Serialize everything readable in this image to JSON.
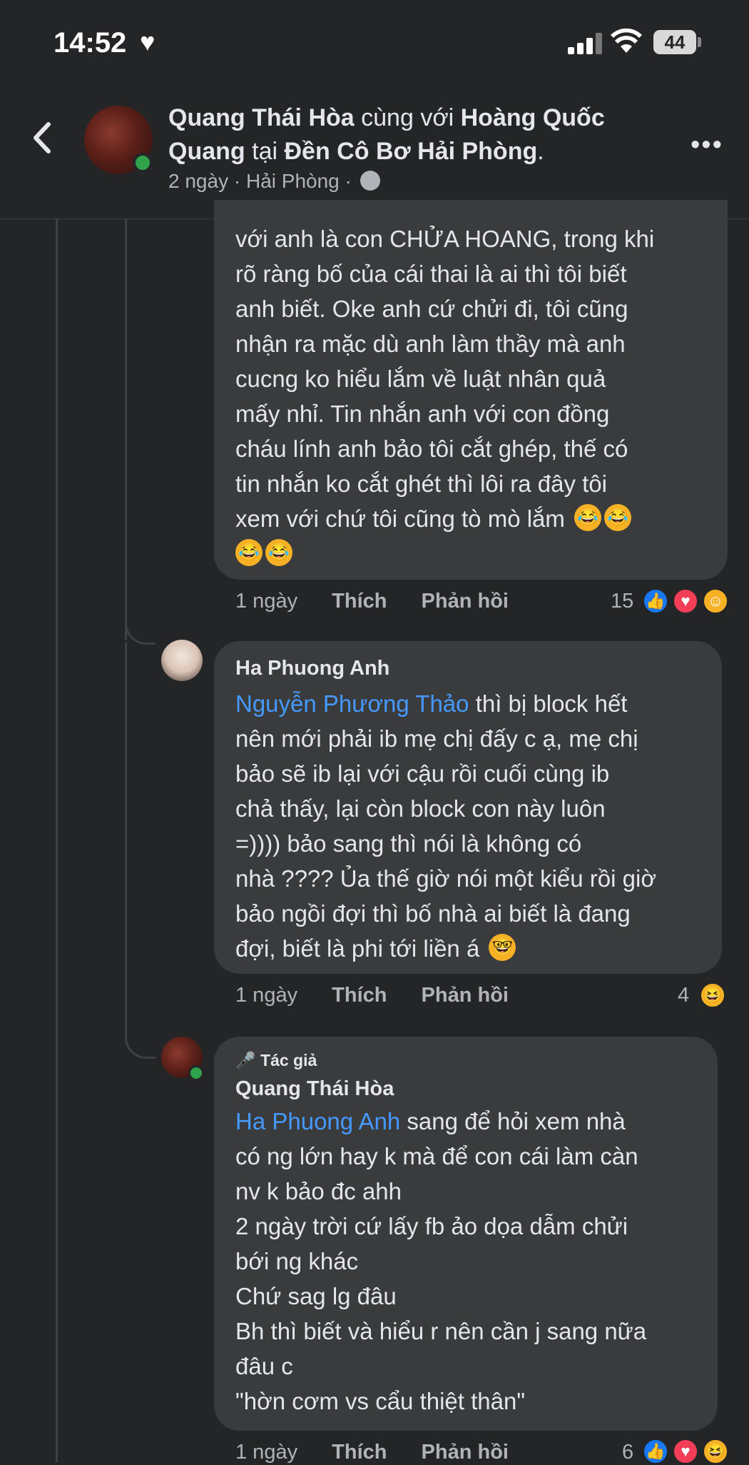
{
  "status_bar": {
    "time": "14:52",
    "battery": "44"
  },
  "header": {
    "author": "Quang Thái Hòa",
    "with_word": "cùng với",
    "tagged": "Hoàng Quốc Quang",
    "at_word": "tại",
    "place": "Đền Cô Bơ Hải Phòng",
    "punct": ".",
    "time": "2 ngày",
    "location": "Hải Phòng",
    "sep": "·"
  },
  "comments": [
    {
      "lines": [
        "với anh là con CHỬA HOANG, trong khi",
        "rõ ràng bố của cái thai là ai thì tôi biết",
        "anh biết. Oke anh cứ chửi đi, tôi cũng",
        "nhận ra mặc dù anh làm thầy mà anh",
        "cucng ko hiểu lắm về luật nhân quả",
        "mấy nhỉ. Tin nhắn anh với con đồng",
        "cháu lính anh bảo tôi cắt ghép, thế có",
        "tin nhắn ko cắt ghét thì lôi ra đây tôi",
        "xem với chứ tôi cũng tò mò lắm"
      ],
      "time": "1 ngày",
      "like": "Thích",
      "reply": "Phản hồi",
      "reaction_count": "15"
    },
    {
      "name": "Ha Phuong Anh",
      "mention": "Nguyễn Phương Thảo",
      "first_rest": "thì bị block hết",
      "lines": [
        "nên mới phải ib mẹ chị đấy c ạ, mẹ chị",
        "bảo sẽ ib lại với cậu rồi cuối cùng ib",
        "chả thấy, lại còn block con này luôn",
        "=)))) bảo sang thì nói là không có",
        "nhà ???? Ủa thế giờ nói một kiểu rồi giờ",
        "bảo ngồi đợi thì bố nhà ai biết là đang",
        "đợi, biết là phi tới liền á"
      ],
      "time": "1 ngày",
      "like": "Thích",
      "reply": "Phản hồi",
      "reaction_count": "4"
    },
    {
      "badge": "Tác giả",
      "name": "Quang Thái Hòa",
      "mention": "Ha Phuong Anh",
      "first_rest": "sang để hỏi xem nhà",
      "lines": [
        "có ng lớn hay k mà để con cái làm càn",
        "nv k bảo đc ahh",
        "2 ngày trời cứ lấy fb ảo dọa dẫm chửi",
        "bới ng khác",
        "Chứ sag lg đâu",
        "Bh thì biết và hiểu r nên cần j sang nữa",
        "đâu c",
        "\"hờn cơm vs cẩu thiệt thân\""
      ],
      "time": "1 ngày",
      "like": "Thích",
      "reply": "Phản hồi",
      "reaction_count": "6"
    }
  ],
  "icons": {
    "back": "chevron-left-icon",
    "more": "more-horizontal-icon",
    "privacy": "globe-icon",
    "author_badge": "microphone-icon"
  },
  "colors": {
    "background": "#242526",
    "bubble": "#3a3b3c",
    "mention": "#4599ff",
    "online": "#31a24c"
  }
}
